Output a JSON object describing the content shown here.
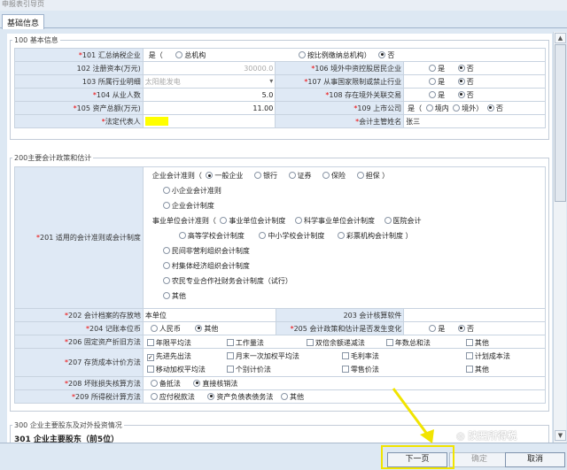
{
  "window_title": "申报表引导页",
  "tab": "基础信息",
  "s100": {
    "title": "100 基本信息",
    "r1": {
      "n": "*",
      "label": "101 汇总纳税企业",
      "opt1": "是（",
      "opt2": "总机构",
      "opt3": "按比例缴纳总机构）",
      "opt4": "否"
    },
    "r2": {
      "label": "102 注册资本(万元)",
      "value": "30000.0",
      "n2": "*",
      "label2": "106 境外中资控股居民企业",
      "yes": "是",
      "no": "否"
    },
    "r3": {
      "label": "103 所属行业明细",
      "value": "太阳能发电",
      "arrow": "▾",
      "n2": "*",
      "label2": "107 从事国家限制或禁止行业",
      "yes": "是",
      "no": "否"
    },
    "r4": {
      "n": "*",
      "label": "104 从业人数",
      "value": "5.0",
      "n2": "*",
      "label2": "108 存在境外关联交易",
      "yes": "是",
      "no": "否"
    },
    "r5": {
      "n": "*",
      "label": "105 资产总额(万元)",
      "value": "11.00",
      "n2": "*",
      "label2": "109 上市公司",
      "yes": "是（",
      "opt2": "境内",
      "opt3": "境外）",
      "no": "否"
    },
    "r6": {
      "n": "*",
      "label": "法定代表人",
      "n2": "*",
      "label2": "会计主管姓名",
      "value2": "张三"
    }
  },
  "s200": {
    "title": "200主要会计政策和估计",
    "r201": {
      "n": "*",
      "label": "201 适用的会计准则或会计制度"
    },
    "policy": {
      "line1": {
        "lead": "企业会计准则（",
        "o1": "一般企业",
        "o2": "银行",
        "o3": "证券",
        "o4": "保险",
        "o5": "担保 ）"
      },
      "line2": "小企业会计准则",
      "line3": "企业会计制度",
      "line4": {
        "lead": "事业单位会计准则（",
        "o1": "事业单位会计制度",
        "o2": "科学事业单位会计制度",
        "o3": "医院会计"
      },
      "line5": {
        "o1": "高等学校会计制度",
        "o2": "中小学校会计制度",
        "o3": "彩票机构会计制度 ）"
      },
      "line6": "民间非营利组织会计制度",
      "line7": "村集体经济组织会计制度",
      "line8": "农民专业合作社财务会计制度（试行）",
      "line9": "其他"
    },
    "r202": {
      "n": "*",
      "label": "202 会计档案的存放地",
      "value": "本单位",
      "label2": "203 会计核算软件"
    },
    "r204": {
      "n": "*",
      "label": "204 记账本位币",
      "o1": "人民币",
      "o2": "其他",
      "n2": "*",
      "label2": "205 会计政策和估计是否发生变化",
      "yes": "是",
      "no": "否"
    },
    "r206": {
      "n": "*",
      "label": "206 固定资产折旧方法",
      "o1": "年限平均法",
      "o2": "工作量法",
      "o3": "双倍余额递减法",
      "o4": "年数总和法",
      "o5": "其他"
    },
    "r207": {
      "n": "*",
      "label": "207 存货成本计价方法",
      "o1": "先进先出法",
      "o2": "月末一次加权平均法",
      "o3": "毛利率法",
      "o4": "计划成本法",
      "o5": "移动加权平均法",
      "o6": "个别计价法",
      "o7": "零售价法",
      "o8": "其他"
    },
    "r208": {
      "n": "*",
      "label": "208 坏账损失核算方法",
      "o1": "备抵法",
      "o2": "直接核销法"
    },
    "r209": {
      "n": "*",
      "label": "209 所得税计算方法",
      "o1": "应付税款法",
      "o2": "资产负债表债务法",
      "o3": "其他"
    }
  },
  "s300": {
    "title": "300 企业主要股东及对外投资情况",
    "sub": "301 企业主要股东（前5位）"
  },
  "buttons": {
    "next": "下一页",
    "confirm": "确定",
    "cancel": "取消"
  },
  "watermark": "陕西所得税",
  "scroll": {
    "up": "▲",
    "down": "▼"
  },
  "colors": {
    "label_bg": "#dfe9f5",
    "required": "#ff0000",
    "highlight": "#f1e400",
    "legal_rep_fill": "#ffff00"
  }
}
